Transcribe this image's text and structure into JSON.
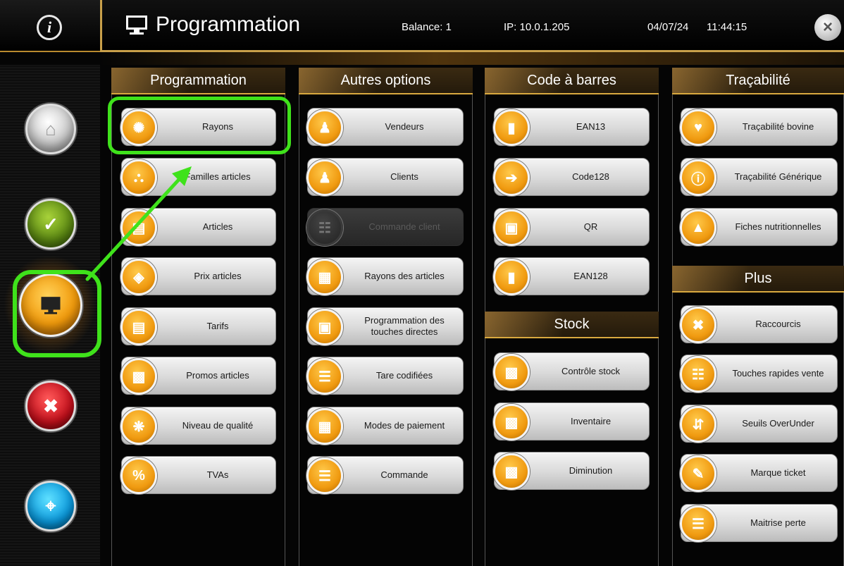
{
  "header": {
    "title": "Programmation",
    "balance": "Balance: 1",
    "ip": "IP: 10.0.1.205",
    "date": "04/07/24",
    "time": "11:44:15",
    "info_glyph": "i",
    "close_glyph": "×"
  },
  "nav": [
    {
      "name": "home",
      "icon": "home-icon"
    },
    {
      "name": "validate",
      "icon": "check-icon"
    },
    {
      "name": "programmation",
      "icon": "monitor-icon",
      "active": true
    },
    {
      "name": "tools",
      "icon": "tools-icon"
    },
    {
      "name": "network",
      "icon": "wifi-icon"
    }
  ],
  "columns": {
    "programmation": {
      "title": "Programmation",
      "items": [
        "Rayons",
        "Familles articles",
        "Articles",
        "Prix articles",
        "Tarifs",
        "Promos articles",
        "Niveau de qualité",
        "TVAs"
      ]
    },
    "autres": {
      "title": "Autres options",
      "items": [
        "Vendeurs",
        "Clients",
        "Commande client",
        "Rayons des articles",
        "Programmation des touches directes",
        "Tare codifiées",
        "Modes de paiement",
        "Commande"
      ]
    },
    "barcode": {
      "title": "Code à barres",
      "items": [
        "EAN13",
        "Code128",
        "QR",
        "EAN128"
      ]
    },
    "stock": {
      "title": "Stock",
      "items": [
        "Contrôle stock",
        "Inventaire",
        "Diminution"
      ]
    },
    "tracabilite": {
      "title": "Traçabilité",
      "items": [
        "Traçabilité bovine",
        "Traçabilité Générique",
        "Fiches nutritionnelles"
      ]
    },
    "plus": {
      "title": "Plus",
      "items": [
        "Raccourcis",
        "Touches rapides vente",
        "Seuils OverUnder",
        "Marque ticket",
        "Maitrise perte"
      ]
    }
  },
  "colors": {
    "accent_gold": "#d9a93f",
    "highlight_green": "#3fe21b",
    "icon_orange": "#f09a10"
  }
}
